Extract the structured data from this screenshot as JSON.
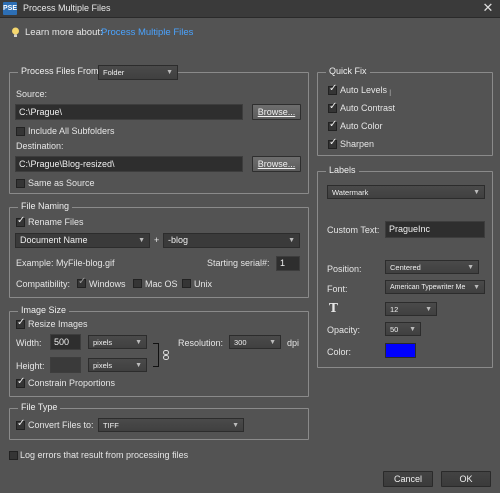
{
  "window": {
    "title": "Process Multiple Files",
    "app_icon": "pse-app-icon"
  },
  "tip": {
    "prefix": "Learn more about:",
    "link": "Process Multiple Files"
  },
  "process_files": {
    "legend": "Process Files From:",
    "from_value": "Folder",
    "source_label": "Source:",
    "source_value": "C:\\Prague\\",
    "browse1": "Browse...",
    "include_subfolders": "Include All Subfolders",
    "destination_label": "Destination:",
    "destination_value": "C:\\Prague\\Blog-resized\\",
    "browse2": "Browse...",
    "same_as_source": "Same as Source"
  },
  "file_naming": {
    "legend": "File Naming",
    "rename_files": "Rename Files",
    "name_option": "Document Name",
    "plus": "+",
    "suffix": "-blog",
    "example": "Example: MyFile-blog.gif",
    "starting_serial_label": "Starting serial#:",
    "starting_serial_value": "1",
    "compatibility_label": "Compatibility:",
    "windows": "Windows",
    "mac_os": "Mac OS",
    "unix": "Unix"
  },
  "image_size": {
    "legend": "Image Size",
    "resize_images": "Resize Images",
    "width_label": "Width:",
    "width_value": "500",
    "width_unit": "pixels",
    "height_label": "Height:",
    "height_value": "",
    "height_unit": "pixels",
    "resolution_label": "Resolution:",
    "resolution_value": "300",
    "resolution_unit": "dpi",
    "constrain": "Constrain Proportions"
  },
  "file_type": {
    "legend": "File Type",
    "convert_label": "Convert Files to:",
    "convert_value": "TIFF"
  },
  "log_errors": "Log errors that result from processing files",
  "quick_fix": {
    "legend": "Quick Fix",
    "auto_levels": "Auto Levels",
    "auto_contrast": "Auto Contrast",
    "auto_color": "Auto Color",
    "sharpen": "Sharpen"
  },
  "labels": {
    "legend": "Labels",
    "type": "Watermark",
    "custom_text_label": "Custom Text:",
    "custom_text_value": "PragueInc",
    "position_label": "Position:",
    "position_value": "Centered",
    "font_label": "Font:",
    "font_value": "American Typewriter Me",
    "size_value": "12",
    "opacity_label": "Opacity:",
    "opacity_value": "50",
    "color_label": "Color:",
    "color_hex": "#0000ff"
  },
  "buttons": {
    "cancel": "Cancel",
    "ok": "OK"
  }
}
